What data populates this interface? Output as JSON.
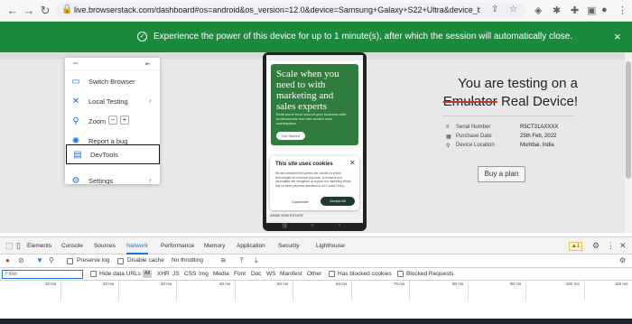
{
  "browser": {
    "url": "live.browserstack.com/dashboard#os=android&os_version=12.0&device=Samsung+Galaxy+S22+Ultra&device_browser=chrome&zoom_t..."
  },
  "banner": {
    "text": "Experience the power of this device for up to 1 minute(s), after which the session will automatically close."
  },
  "device": {
    "hero_title": "Scale when you need to with marketing and sales experts",
    "hero_sub": "Build some buzz around your business with professionals from the world's work marketplace.",
    "hero_button": "Get Started",
    "cookie_title": "This site uses cookies",
    "cookie_body": "We and selected third parties use cookies or similar technologies for technical purposes, to enhance and personalize site navigation, to support our marketing efforts, and for other purposes described in our Cookie Policy.",
    "cookie_customize": "Customize",
    "cookie_accept": "Accept All",
    "footer_text": "ARAB 1930 ESTATE"
  },
  "panel": {
    "heading_prefix": "You are testing on a",
    "heading_strike": "Emulator",
    "heading_suffix": "Real Device!",
    "serial_label": "Serial Number",
    "serial_value": "R5CT31AXXXX",
    "purchase_label": "Purchase Date",
    "purchase_value": "25th Feb, 2022",
    "location_label": "Device Location",
    "location_value": "Mumbai, India",
    "buy_button": "Buy a plan"
  },
  "menu": {
    "items": [
      {
        "label": "Switch Browser",
        "icon": "monitor-icon"
      },
      {
        "label": "Local Testing",
        "icon": "local-testing-icon"
      },
      {
        "label": "Zoom",
        "icon": "zoom-icon"
      },
      {
        "label": "Report a bug",
        "icon": "bug-icon"
      },
      {
        "label": "DevTools",
        "icon": "devtools-icon"
      },
      {
        "label": "Settings",
        "icon": "gear-icon"
      }
    ],
    "zoom_minus": "−",
    "zoom_plus": "+"
  },
  "devtools": {
    "tabs": [
      "Elements",
      "Console",
      "Sources",
      "Network",
      "Performance",
      "Memory",
      "Application",
      "Security",
      "Lighthouse"
    ],
    "active_tab": "Network",
    "warning_count": "1",
    "preserve_log": "Preserve log",
    "disable_cache": "Disable cache",
    "throttling": "No throttling",
    "filter_placeholder": "Filter",
    "hide_data_urls": "Hide data URLs",
    "types": [
      "All",
      "XHR",
      "JS",
      "CSS",
      "Img",
      "Media",
      "Font",
      "Doc",
      "WS",
      "Manifest",
      "Other"
    ],
    "has_blocked_cookies": "Has blocked cookies",
    "blocked_requests": "Blocked Requests",
    "ticks": [
      "10 ms",
      "20 ms",
      "30 ms",
      "40 ms",
      "50 ms",
      "60 ms",
      "70 ms",
      "80 ms",
      "90 ms",
      "100 ms",
      "110 ms"
    ]
  },
  "colors": {
    "banner": "#1c8a3d",
    "accent": "#1a73e8",
    "hero": "#2f7d3c"
  }
}
